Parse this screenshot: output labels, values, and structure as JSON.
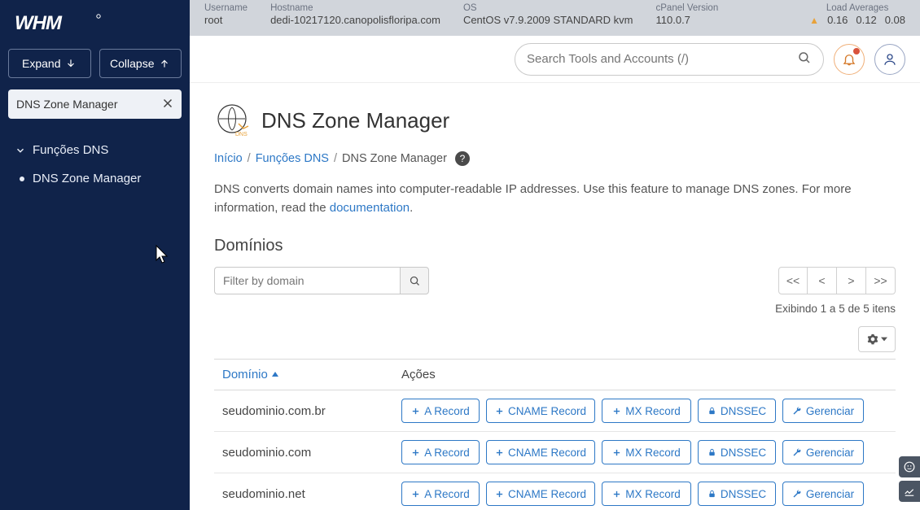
{
  "logo_text": "WHM",
  "sidebar": {
    "expand": "Expand",
    "collapse": "Collapse",
    "search_value": "DNS Zone Manager",
    "group": "Funções DNS",
    "item": "DNS Zone Manager"
  },
  "topbar": {
    "username_lbl": "Username",
    "username": "root",
    "hostname_lbl": "Hostname",
    "hostname": "dedi-10217120.canopolisfloripa.com",
    "os_lbl": "OS",
    "os": "CentOS v7.9.2009 STANDARD kvm",
    "cpver_lbl": "cPanel Version",
    "cpver": "110.0.7",
    "load_lbl": "Load Averages",
    "load1": "0.16",
    "load2": "0.12",
    "load3": "0.08"
  },
  "toolbar": {
    "search_placeholder": "Search Tools and Accounts (/)"
  },
  "page": {
    "title": "DNS Zone Manager",
    "bc_home": "Início",
    "bc_group": "Funções DNS",
    "bc_current": "DNS Zone Manager",
    "desc_a": "DNS converts domain names into computer-readable IP addresses. Use this feature to manage DNS zones. For more information, read the ",
    "desc_link": "documentation",
    "desc_b": ".",
    "section": "Domínios",
    "filter_placeholder": "Filter by domain",
    "count": "Exibindo 1 a 5 de 5 itens",
    "pg_first": "<<",
    "pg_prev": "<",
    "pg_next": ">",
    "pg_last": ">>",
    "col_domain": "Domínio",
    "col_actions": "Ações"
  },
  "actions": {
    "a": "A Record",
    "cname": "CNAME Record",
    "mx": "MX Record",
    "dnssec": "DNSSEC",
    "manage": "Gerenciar"
  },
  "domains": {
    "r0": "seudominio.com.br",
    "r1": "seudominio.com",
    "r2": "seudominio.net"
  }
}
